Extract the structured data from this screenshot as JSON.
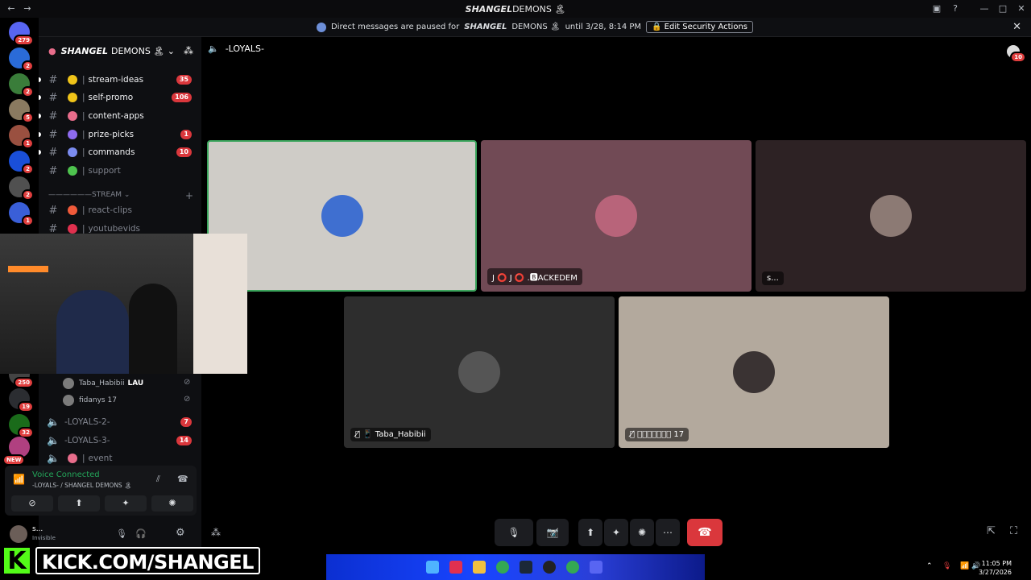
{
  "window": {
    "title_prefix": "SHANGEL",
    "title_suffix": "DEMONS 🏝"
  },
  "banner": {
    "text_before": "Direct messages are paused for",
    "server_bold": "SHANGEL",
    "server_rest": "DEMONS 🏝",
    "text_after": "until 3/28, 8:14 PM",
    "button_label": "🔒 Edit Security Actions"
  },
  "server_badges": [
    "279",
    "2",
    "2",
    "5",
    "1",
    "2",
    "2",
    "1",
    "250",
    "19",
    "32",
    "NEW"
  ],
  "guild": {
    "name_bold": "SHANGEL",
    "name_rest": "DEMONS 🏝 ⌄"
  },
  "channels": [
    {
      "name": "stream-ideas",
      "count": "35",
      "emoji_color": "#f0c419"
    },
    {
      "name": "self-promo",
      "count": "106",
      "emoji_color": "#f0c419"
    },
    {
      "name": "content-apps",
      "count": "",
      "emoji_color": "#e86d8b"
    },
    {
      "name": "prize-picks",
      "count": "1",
      "emoji_color": "#8e6bf0"
    },
    {
      "name": "commands",
      "count": "10",
      "emoji_color": "#7b8cf0"
    },
    {
      "name": "support",
      "count": "",
      "emoji_color": "#4ec34e"
    }
  ],
  "category": {
    "label": "——————STREAM ⌄",
    "plus": "+"
  },
  "stream_channels": [
    {
      "name": "react-clips",
      "emoji_color": "#f05a3a"
    },
    {
      "name": "youtubevids",
      "emoji_color": "#e0304e"
    }
  ],
  "voice_users": [
    {
      "name": "Taba_Habibii",
      "tag": "LAU"
    },
    {
      "name": "fidanys 17",
      "tag": ""
    }
  ],
  "voice_channels": [
    {
      "name": "-LOYALS-2-",
      "count": "7"
    },
    {
      "name": "-LOYALS-3-",
      "count": "14"
    },
    {
      "name": "event",
      "count": ""
    }
  ],
  "voice_panel": {
    "title": "Voice Connected",
    "sub": "-LOYALS- / SHANGEL DEMONS 🏝"
  },
  "user": {
    "name": "s...",
    "status": "Invisible"
  },
  "main": {
    "channel": "-LOYALS-",
    "notif_count": "10"
  },
  "tiles": [
    {
      "label": "",
      "bg": "#cfccc7",
      "avatar": "#3f6fd0"
    },
    {
      "label": "J ⭕ J ⭕ .🅱ACKEDEM",
      "bg": "#714a55",
      "avatar": "#b8647a"
    },
    {
      "label": "s...",
      "bg": "#2d2224",
      "avatar": "#8c7a74"
    },
    {
      "label": "🎙̸ 📱 Taba_Habibii",
      "bg": "#2d2d2d",
      "avatar": "#555"
    },
    {
      "label": "🎙̸ 𝐟𝐢𝐝𝐚𝐧𝐲𝐬 17",
      "bg": "#b3a99d",
      "avatar": "#3a3333"
    }
  ],
  "controls": {
    "mic": "🎙",
    "cam": "📷̸",
    "share": "⬆",
    "activity": "✦",
    "soundboard": "✺",
    "more": "⋯",
    "hangup": "☎"
  },
  "overlay": {
    "kick_letter": "K",
    "kick_url": "KICK.COM/SHANGEL"
  },
  "clock": {
    "time": "11:05 PM",
    "date": "3/27/2026"
  }
}
